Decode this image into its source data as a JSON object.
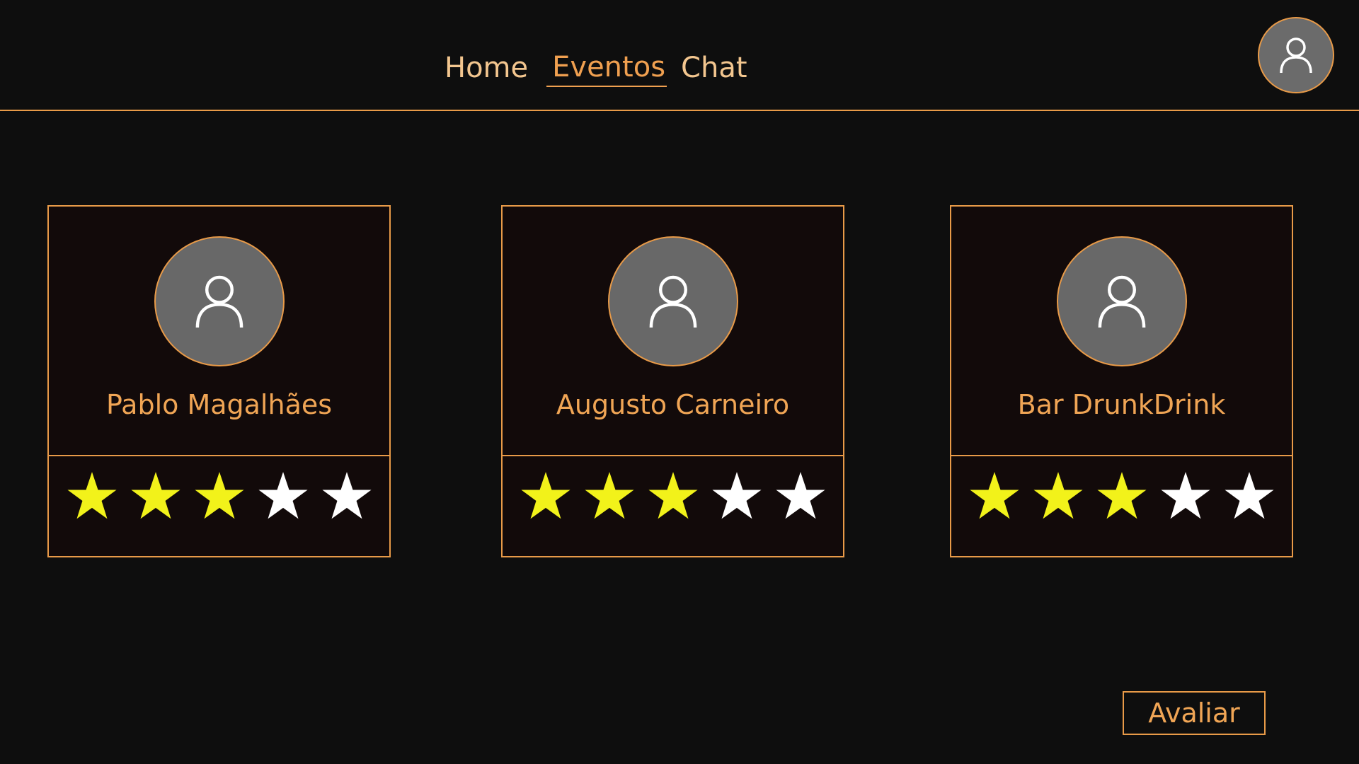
{
  "nav": {
    "home": "Home",
    "eventos": "Eventos",
    "chat": "Chat"
  },
  "profile_icon": "user-icon",
  "cards": [
    {
      "name": "Pablo Magalhães",
      "rating": 3,
      "max_rating": 5
    },
    {
      "name": "Augusto Carneiro",
      "rating": 3,
      "max_rating": 5
    },
    {
      "name": "Bar DrunkDrink",
      "rating": 3,
      "max_rating": 5
    }
  ],
  "actions": {
    "rate_label": "Avaliar"
  },
  "colors": {
    "background": "#0e0e0e",
    "accent": "#e89a48",
    "star_filled": "#f2f21a",
    "star_empty": "#ffffff",
    "avatar_bg": "#686868"
  }
}
